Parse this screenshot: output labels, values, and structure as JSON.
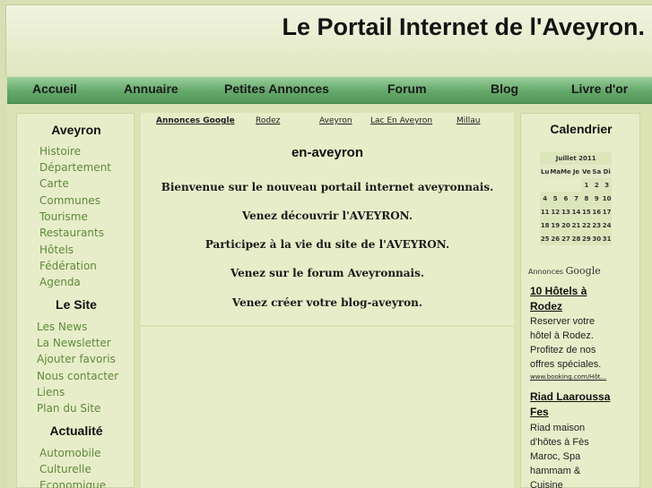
{
  "header": {
    "title": "Le Portail Internet de l'Aveyron."
  },
  "nav": {
    "items": [
      "Accueil",
      "Annuaire",
      "Petites Annonces",
      "Forum",
      "Blog",
      "Livre d'or"
    ]
  },
  "left": {
    "aveyron_title": "Aveyron",
    "aveyron_links": [
      "Histoire",
      "Département",
      "Carte",
      "Communes",
      "Tourisme",
      "Restaurants",
      "Hôtels",
      "Fédération",
      "Agenda"
    ],
    "site_title": "Le Site",
    "site_links": [
      "Les News",
      "La Newsletter",
      "Ajouter favoris",
      "Nous contacter",
      "Liens",
      "Plan du Site"
    ],
    "actu_title": "Actualité",
    "actu_links": [
      "Automobile",
      "Culturelle",
      "Economique"
    ]
  },
  "center": {
    "ad_links": [
      "Annonces Google",
      "Rodez",
      "Aveyron",
      "Lac En Aveyron",
      "Millau"
    ],
    "heading": "en-aveyron",
    "messages": [
      "Bienvenue sur le nouveau portail internet aveyronnais.",
      "Venez découvrir l'AVEYRON.",
      "Participez à la vie du site de l'AVEYRON.",
      "Venez sur le forum Aveyronnais.",
      "Venez créer votre blog-aveyron."
    ]
  },
  "right": {
    "calendar_title": "Calendrier",
    "calendar": {
      "month": "Juillet 2011",
      "days": [
        "Lu",
        "Ma",
        "Me",
        "Je",
        "Ve",
        "Sa",
        "Di"
      ],
      "weeks": [
        [
          "",
          "",
          "",
          "",
          "1",
          "2",
          "3"
        ],
        [
          "4",
          "5",
          "6",
          "7",
          "8",
          "9",
          "10"
        ],
        [
          "11",
          "12",
          "13",
          "14",
          "15",
          "16",
          "17"
        ],
        [
          "18",
          "19",
          "20",
          "21",
          "22",
          "23",
          "24"
        ],
        [
          "25",
          "26",
          "27",
          "28",
          "29",
          "30",
          "31"
        ]
      ]
    },
    "ads_label": "Annonces",
    "ads_brand": "Google",
    "ads": [
      {
        "title_lines": [
          "10 Hôtels à",
          "Rodez"
        ],
        "text_lines": [
          "Reserver votre",
          "hôtel à Rodez.",
          "Profitez de nos",
          "offres spéciales."
        ],
        "url": "www.booking.com/Hôt..."
      },
      {
        "title_lines": [
          "Riad Laaroussa",
          "Fes"
        ],
        "text_lines": [
          "Riad maison",
          "d'hôtes à Fès",
          "Maroc, Spa",
          "hammam &",
          "Cuisine"
        ]
      }
    ]
  }
}
